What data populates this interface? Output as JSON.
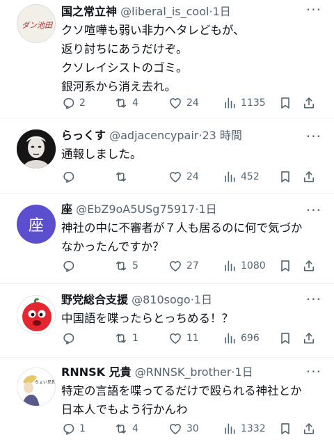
{
  "posts": [
    {
      "name": "国之常立神",
      "handle": "@liberal_is_cool",
      "dot": "·",
      "time": "1日",
      "avatar_text": "ダン池田",
      "lines": [
        "クソ喧嘩も弱い非力ヘタレどもが、",
        "返り討ちにあうだけぞ。",
        "クソレイシストのゴミ。",
        "銀河系から消え去れ。"
      ],
      "replies": "2",
      "retweets": "4",
      "likes": "24",
      "views": "1135"
    },
    {
      "name": "らっくす",
      "handle": "@adjacencypair",
      "dot": "·",
      "time": "23 時間",
      "avatar_text": "",
      "lines": [
        "通報しました。"
      ],
      "replies": "",
      "retweets": "",
      "likes": "24",
      "views": "452"
    },
    {
      "name": "座",
      "handle": "@EbZ9oA5USg75917",
      "dot": "·",
      "time": "1日",
      "avatar_text": "座",
      "lines": [
        "神社の中に不審者が７人も居るのに何で気づか",
        "なかったんですか？"
      ],
      "replies": "",
      "retweets": "5",
      "likes": "27",
      "views": "1080"
    },
    {
      "name": "野党総合支援",
      "handle": "@810sogo",
      "dot": "·",
      "time": "1日",
      "avatar_text": "",
      "lines": [
        "中国語を喋ったらとっちめる！？"
      ],
      "replies": "",
      "retweets": "1",
      "likes": "11",
      "views": "696"
    },
    {
      "name": "RNNSK 兄貴",
      "handle": "@RNNSK_brother",
      "dot": "·",
      "time": "1日",
      "avatar_text": "ちょい兄貴",
      "lines": [
        "特定の言語を喋ってるだけで殴られる神社とか",
        "日本人でもよう行かんわ"
      ],
      "replies": "1",
      "retweets": "4",
      "likes": "30",
      "views": "1332"
    }
  ],
  "icons": {
    "reply": "reply-icon",
    "retweet": "retweet-icon",
    "like": "like-icon",
    "views": "views-icon",
    "bookmark": "bookmark-icon",
    "share": "share-icon",
    "more": "more-icon"
  },
  "colors": {
    "text": "#0f1419",
    "muted": "#536471",
    "divider": "#eff3f4",
    "avatar_purple": "#5b4fcf"
  }
}
